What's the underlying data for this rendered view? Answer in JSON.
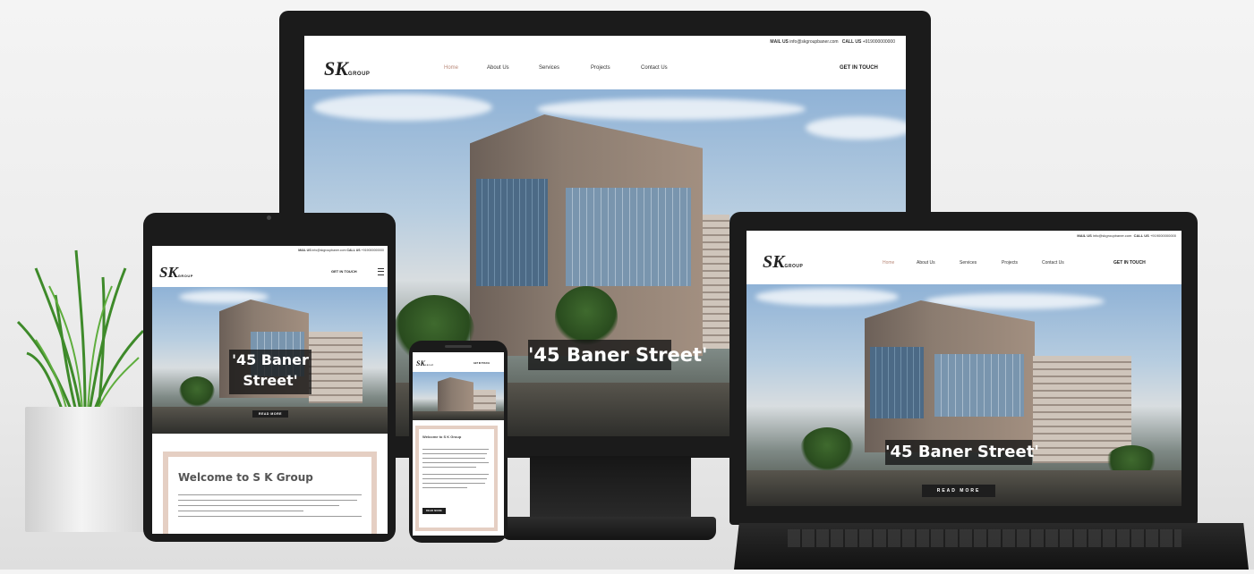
{
  "topbar": {
    "mail_label": "MAIL US",
    "mail_value": "info@skgroupbaner.com",
    "call_label": "CALL US",
    "call_value": "+919000000000"
  },
  "logo": {
    "main": "SK",
    "sub": "GROUP"
  },
  "nav": {
    "items": [
      "Home",
      "About Us",
      "Services",
      "Projects",
      "Contact Us"
    ],
    "cta": "GET IN TOUCH"
  },
  "hero": {
    "headline": "'45 Baner Street'",
    "headline_tablet": [
      "'45 Baner",
      "Street'"
    ],
    "read_more": "READ MORE"
  },
  "welcome": {
    "title": "Welcome to S K Group",
    "title_phone": "Welcome to S K Group",
    "button": "READ MORE"
  },
  "colors": {
    "accent": "#b98a7a",
    "frame": "#1b1b1b",
    "border": "#e5cfc3"
  }
}
